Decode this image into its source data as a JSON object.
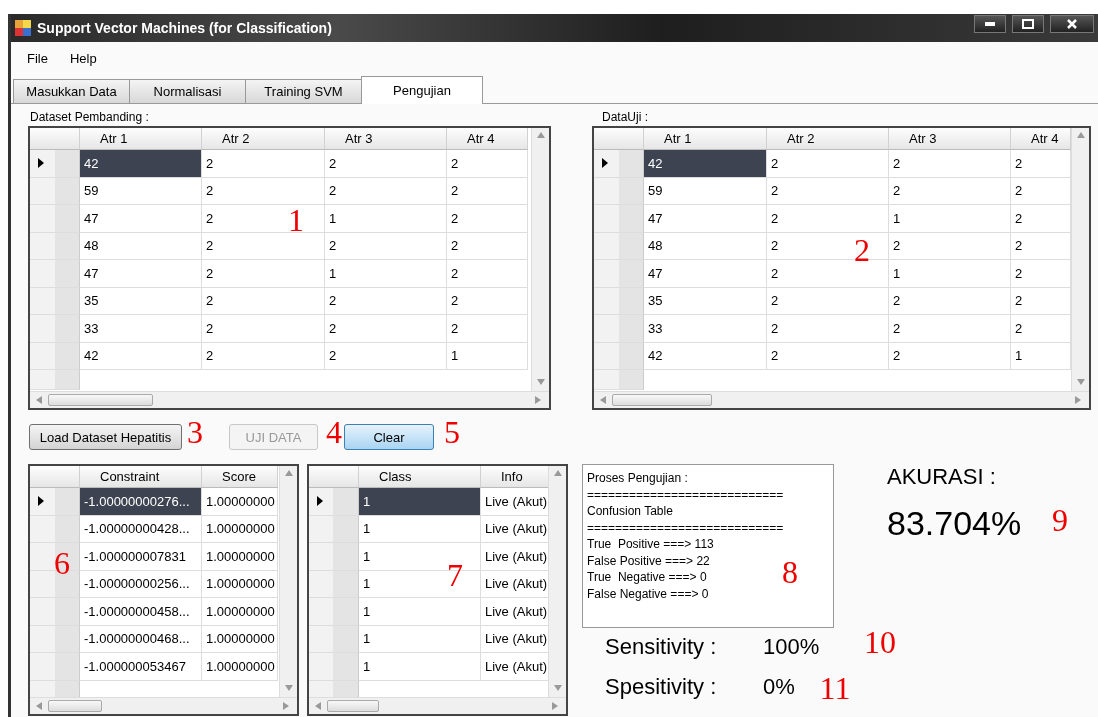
{
  "window": {
    "title": "Support Vector Machines (for Classification)"
  },
  "menu": [
    "File",
    "Help"
  ],
  "tabs": [
    {
      "label": "Masukkan Data",
      "selected": false
    },
    {
      "label": "Normalisasi",
      "selected": false
    },
    {
      "label": "Training SVM",
      "selected": false
    },
    {
      "label": "Pengujian",
      "selected": true
    }
  ],
  "dataset_pembanding": {
    "label": "Dataset Pembanding :",
    "columns": [
      "Atr 1",
      "Atr 2",
      "Atr 3",
      "Atr 4"
    ],
    "rows": [
      {
        "cells": [
          "42",
          "2",
          "2",
          "2"
        ],
        "selected": true
      },
      {
        "cells": [
          "59",
          "2",
          "2",
          "2"
        ],
        "selected": false
      },
      {
        "cells": [
          "47",
          "2",
          "1",
          "2"
        ],
        "selected": false
      },
      {
        "cells": [
          "48",
          "2",
          "2",
          "2"
        ],
        "selected": false
      },
      {
        "cells": [
          "47",
          "2",
          "1",
          "2"
        ],
        "selected": false
      },
      {
        "cells": [
          "35",
          "2",
          "2",
          "2"
        ],
        "selected": false
      },
      {
        "cells": [
          "33",
          "2",
          "2",
          "2"
        ],
        "selected": false
      },
      {
        "cells": [
          "42",
          "2",
          "2",
          "1"
        ],
        "selected": false
      }
    ]
  },
  "data_uji": {
    "label": "DataUji :",
    "columns": [
      "Atr 1",
      "Atr 2",
      "Atr 3",
      "Atr 4"
    ],
    "rows": [
      {
        "cells": [
          "42",
          "2",
          "2",
          "2"
        ],
        "selected": true
      },
      {
        "cells": [
          "59",
          "2",
          "2",
          "2"
        ],
        "selected": false
      },
      {
        "cells": [
          "47",
          "2",
          "1",
          "2"
        ],
        "selected": false
      },
      {
        "cells": [
          "48",
          "2",
          "2",
          "2"
        ],
        "selected": false
      },
      {
        "cells": [
          "47",
          "2",
          "1",
          "2"
        ],
        "selected": false
      },
      {
        "cells": [
          "35",
          "2",
          "2",
          "2"
        ],
        "selected": false
      },
      {
        "cells": [
          "33",
          "2",
          "2",
          "2"
        ],
        "selected": false
      },
      {
        "cells": [
          "42",
          "2",
          "2",
          "1"
        ],
        "selected": false
      }
    ]
  },
  "buttons": [
    {
      "label": "Load Dataset Hepatitis",
      "disabled": false,
      "focused": false
    },
    {
      "label": "UJI DATA",
      "disabled": true,
      "focused": false
    },
    {
      "label": "Clear",
      "disabled": false,
      "focused": true
    }
  ],
  "constraint_grid": {
    "columns": [
      "Constraint",
      "Score"
    ],
    "rows": [
      {
        "cells": [
          "-1.00000000276...",
          "1.00000000"
        ],
        "selected": true
      },
      {
        "cells": [
          "-1.00000000428...",
          "1.00000000"
        ],
        "selected": false
      },
      {
        "cells": [
          "-1.000000007831",
          "1.00000000"
        ],
        "selected": false
      },
      {
        "cells": [
          "-1.00000000256...",
          "1.00000000"
        ],
        "selected": false
      },
      {
        "cells": [
          "-1.00000000458...",
          "1.00000000"
        ],
        "selected": false
      },
      {
        "cells": [
          "-1.00000000468...",
          "1.00000000"
        ],
        "selected": false
      },
      {
        "cells": [
          "-1.000000053467",
          "1.00000000"
        ],
        "selected": false
      }
    ]
  },
  "class_grid": {
    "columns": [
      "Class",
      "Info"
    ],
    "rows": [
      {
        "cells": [
          "1",
          "Live (Akut)"
        ],
        "selected": true
      },
      {
        "cells": [
          "1",
          "Live (Akut)"
        ],
        "selected": false
      },
      {
        "cells": [
          "1",
          "Live (Akut)"
        ],
        "selected": false
      },
      {
        "cells": [
          "1",
          "Live (Akut)"
        ],
        "selected": false
      },
      {
        "cells": [
          "1",
          "Live (Akut)"
        ],
        "selected": false
      },
      {
        "cells": [
          "1",
          "Live (Akut)"
        ],
        "selected": false
      },
      {
        "cells": [
          "1",
          "Live (Akut)"
        ],
        "selected": false
      }
    ]
  },
  "proses_pengujian": {
    "lines": [
      "Proses Pengujian :",
      "============================",
      "Confusion Table",
      "============================",
      "True  Positive ===> 113",
      "False Positive ===> 22",
      "True  Negative ===> 0",
      "False Negative ===> 0"
    ]
  },
  "akurasi": {
    "label": "AKURASI :",
    "value": "83.704%"
  },
  "metrics": [
    {
      "label": "Sensitivity :",
      "value": "100%"
    },
    {
      "label": "Spesitivity :",
      "value": "0%"
    }
  ],
  "annotations": [
    "1",
    "2",
    "3",
    "4",
    "5",
    "6",
    "7",
    "8",
    "9",
    "10",
    "11"
  ]
}
